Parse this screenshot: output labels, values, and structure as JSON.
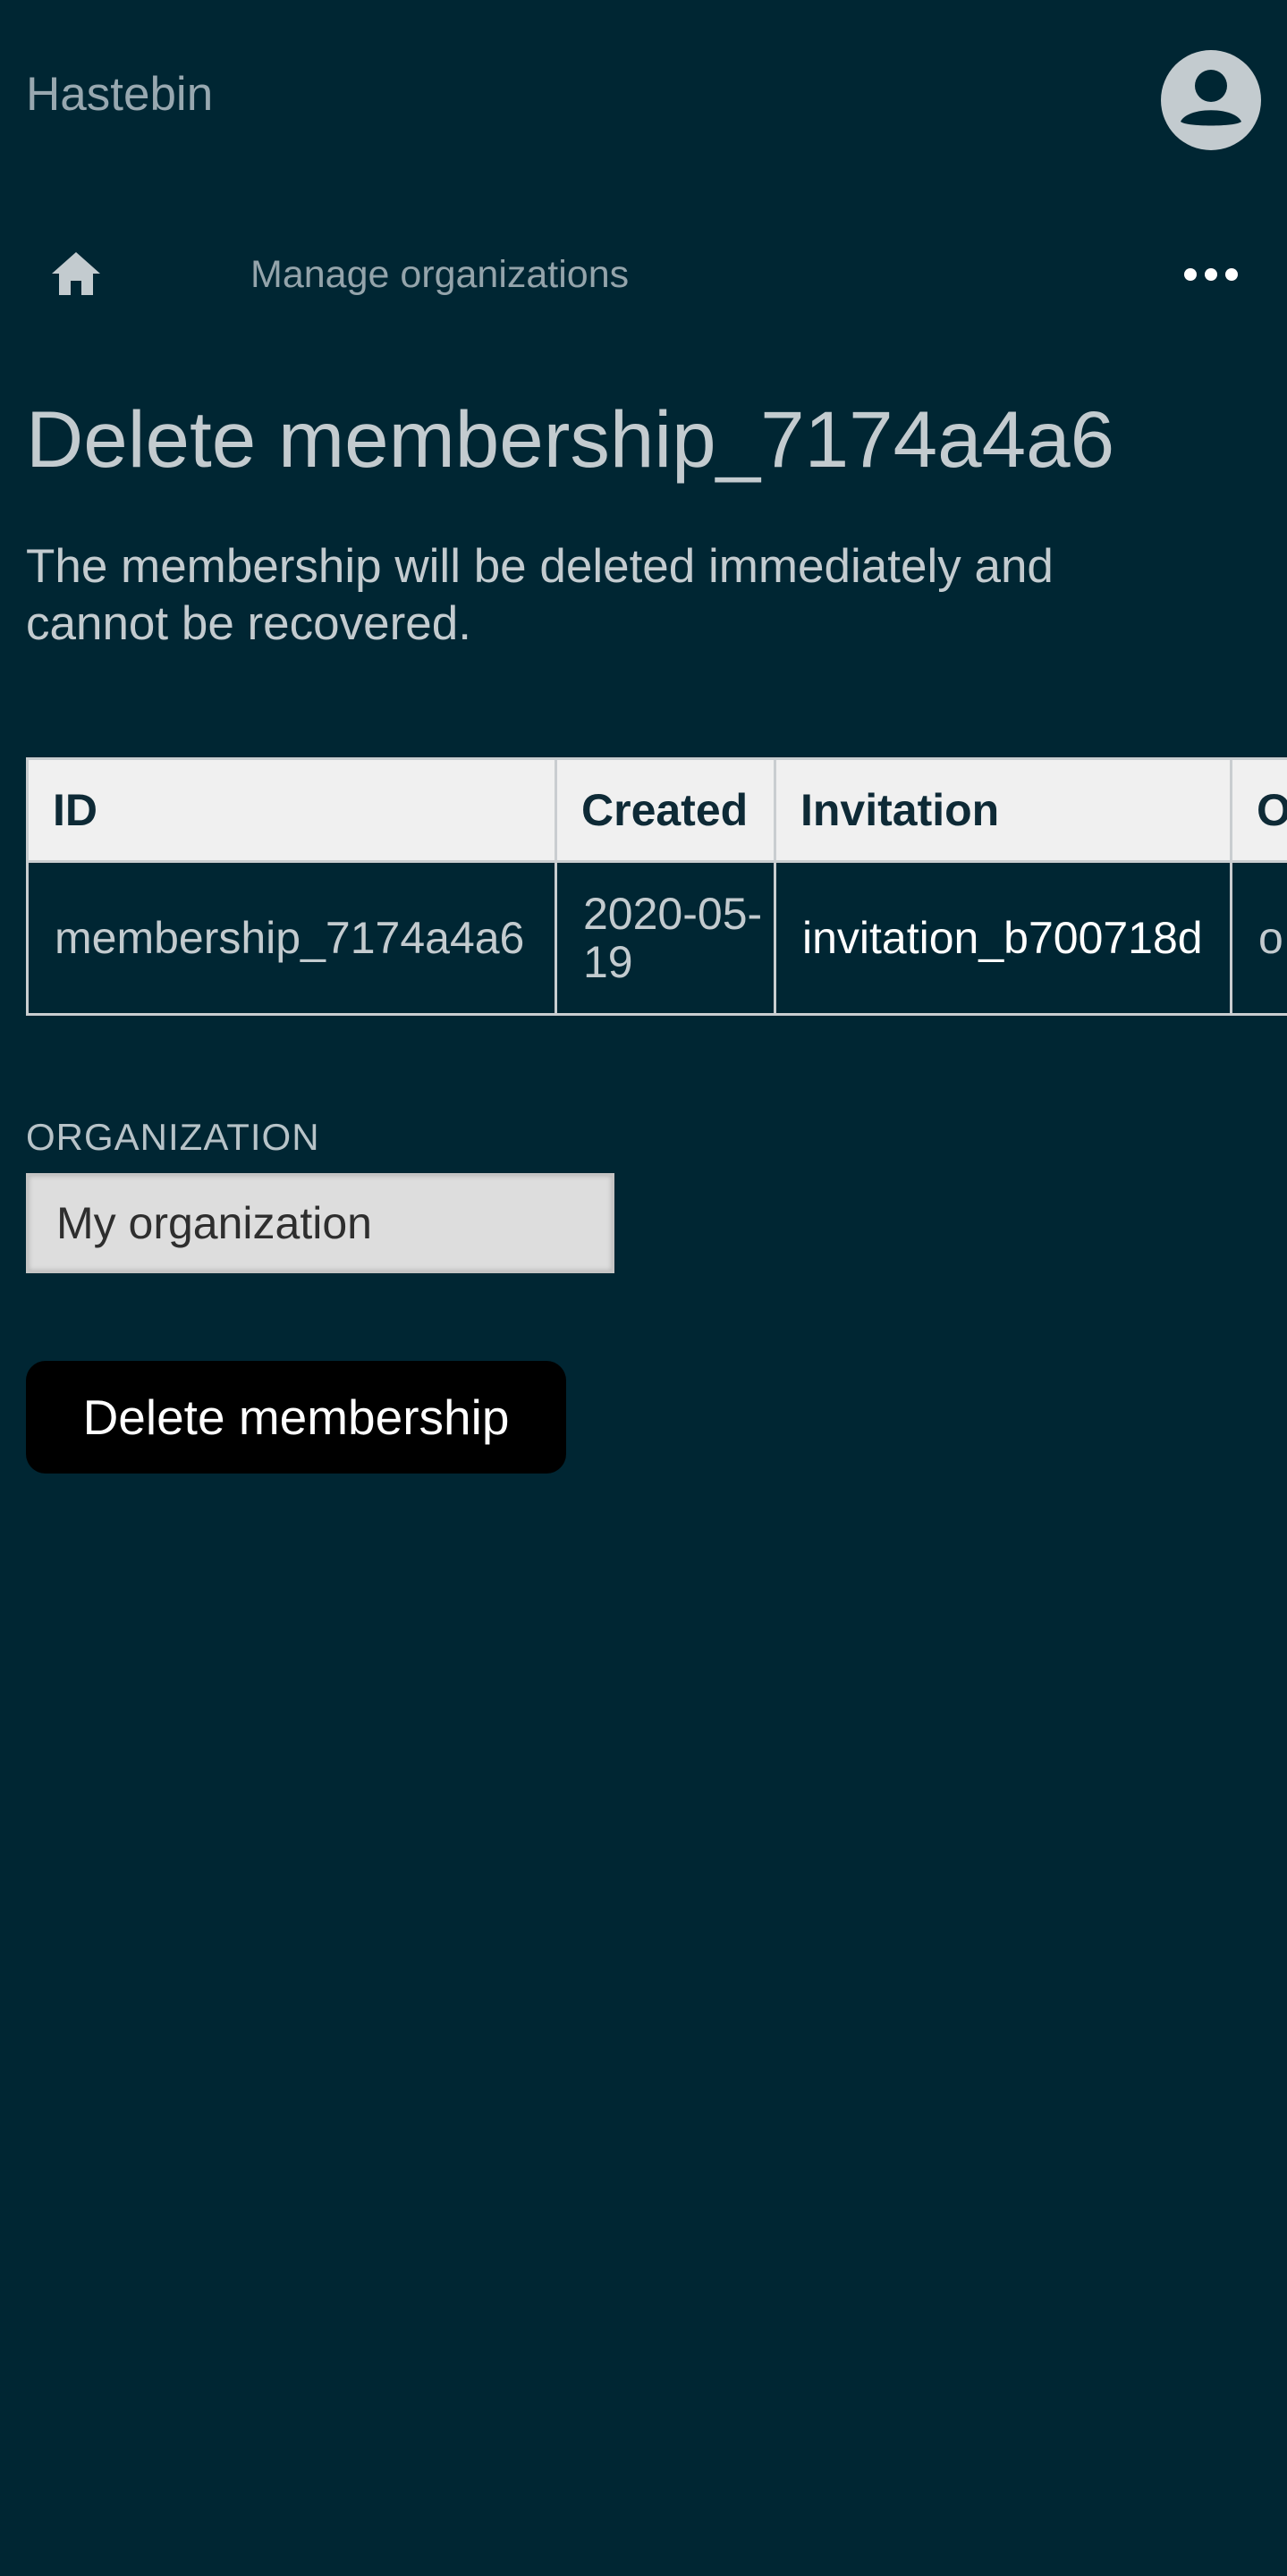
{
  "app": {
    "title": "Hastebin"
  },
  "icons": {
    "avatar": "user-avatar-icon",
    "home": "home-icon",
    "more": "more-horizontal-icon"
  },
  "nav": {
    "link_label": "Manage organizations"
  },
  "page": {
    "title": "Delete membership_7174a4a6",
    "description": "The membership will be deleted immediately and cannot be recovered."
  },
  "table": {
    "headers": [
      "ID",
      "Created",
      "Invitation",
      "O"
    ],
    "rows": [
      [
        "membership_7174a4a6",
        "2020-05-19",
        "invitation_b700718d",
        "o"
      ]
    ]
  },
  "form": {
    "organization_label": "ORGANIZATION",
    "organization_value": "My organization"
  },
  "actions": {
    "delete_label": "Delete membership"
  },
  "colors": {
    "background": "#002633",
    "text": "#c3cbcf",
    "header_bg": "#f0f0f0",
    "button_bg": "#000000"
  }
}
